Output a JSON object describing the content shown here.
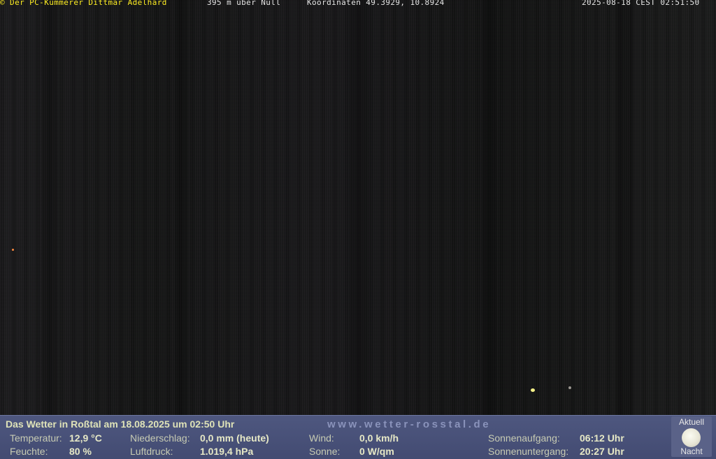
{
  "overlay": {
    "copyright": "© Der PC-Kümmerer Dittmar Adelhard",
    "altitude": "395 m über Null",
    "coordinates": "Koordinaten 49.3929, 10.8924",
    "timestamp": "2025-08-18 CEST 02:51:50"
  },
  "weather_panel": {
    "title": "Das Wetter in Roßtal am 18.08.2025 um 02:50 Uhr",
    "url": "www.wetter-rosstal.de",
    "temperature_label": "Temperatur:",
    "temperature_value": "12,9 °C",
    "humidity_label": "Feuchte:",
    "humidity_value": "80 %",
    "precipitation_label": "Niederschlag:",
    "precipitation_value": "0,0 mm (heute)",
    "pressure_label": "Luftdruck:",
    "pressure_value": "1.019,4 hPa",
    "wind_label": "Wind:",
    "wind_value": "0,0 km/h",
    "sun_label": "Sonne:",
    "sun_value": "0 W/qm",
    "sunrise_label": "Sonnenaufgang:",
    "sunrise_value": "06:12 Uhr",
    "sunset_label": "Sonnenuntergang:",
    "sunset_value": "20:27 Uhr",
    "moon_top_label": "Aktuell",
    "moon_bottom_label": "Nacht",
    "moon_icon": "full-moon-icon"
  },
  "colors": {
    "overlay_text": "#ffee22",
    "panel_background": "#4e577f",
    "panel_text": "#e6e8c6"
  }
}
